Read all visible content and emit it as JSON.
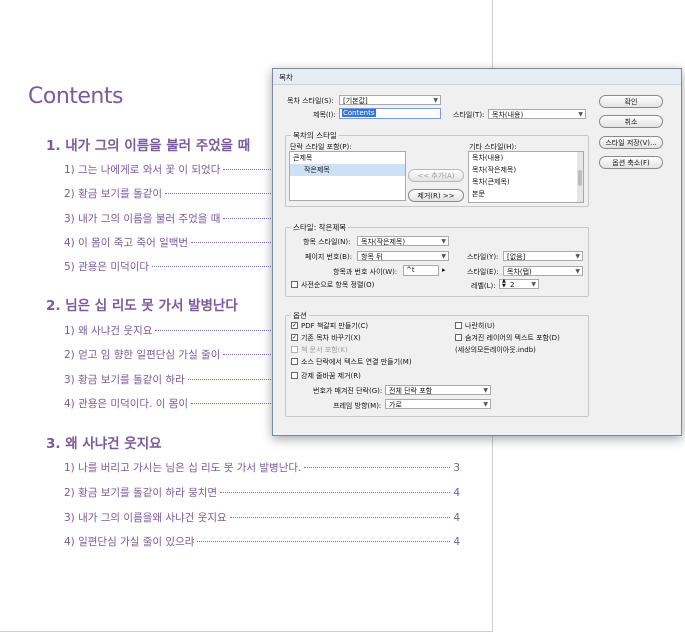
{
  "document": {
    "toc_title": "Contents",
    "sections": [
      {
        "heading": "1. 내가 그의 이름을 불러 주었을 때",
        "items": [
          {
            "text": "1) 그는 나에게로 와서 꽃 이 되었다",
            "page": ""
          },
          {
            "text": "2) 황금 보기를 돌같이",
            "page": ""
          },
          {
            "text": "3) 내가 그의 이름을 불러 주었을 때",
            "page": ""
          },
          {
            "text": "4) 이 몸이 죽고 죽어 일백번",
            "page": ""
          },
          {
            "text": "5) 관용은 미덕이다",
            "page": ""
          }
        ]
      },
      {
        "heading": "2. 님은 십 리도 못 가서 발병난다",
        "items": [
          {
            "text": "1) 왜 사냐건 웃지요",
            "page": ""
          },
          {
            "text": "2) 얻고 임 향한 일편단심 가실 줄이",
            "page": ""
          },
          {
            "text": "3) 황금 보기를 돌같이 하라",
            "page": ""
          },
          {
            "text": "4) 관용은 미덕이다. 이 몸이",
            "page": ""
          }
        ]
      },
      {
        "heading": "3. 왜 사냐건 웃지요",
        "items": [
          {
            "text": "1) 나를 버리고 가시는 님은 십 리도 못 가서 발병난다.",
            "page": "3"
          },
          {
            "text": "2) 황금 보기를 돌같이 하라 뭉치면",
            "page": "4"
          },
          {
            "text": "3) 내가 그의 이름을왜 사냐건 웃지요",
            "page": "4"
          },
          {
            "text": "4) 일편단심 가실 줄이 있으랴",
            "page": "4"
          }
        ]
      }
    ]
  },
  "dialog": {
    "title": "목차",
    "toc_style_label": "목차 스타일(S):",
    "toc_style_value": "[기본값]",
    "title_label": "제목(I):",
    "title_value": "Contents",
    "style_label": "스타일(T):",
    "style_value": "목차(내용)",
    "buttons": {
      "ok": "확인",
      "cancel": "취소",
      "save_style": "스타일 저장(V)...",
      "fewer_options": "옵션 축소(F)",
      "add": "<< 추가(A)",
      "remove": "제거(R) >>"
    },
    "toc_styles_group": "목차의 스타일",
    "include_label": "단락 스타일 포함(P):",
    "include_items": [
      "큰제목",
      "작은제목"
    ],
    "other_label": "기타 스타일(H):",
    "other_items": [
      "목차(내용)",
      "목차(작은제목)",
      "목차(큰제목)",
      "본문"
    ],
    "style_section_group": "스타일: 작은제목",
    "entry_style_label": "항목 스타일(N):",
    "entry_style_value": "목차(작은제목)",
    "page_number_label": "페이지 번호(B):",
    "page_number_value": "항목 뒤",
    "page_style_label": "스타일(Y):",
    "page_style_value": "[없음]",
    "between_label": "항목과 번호 사이(W):",
    "between_value": "^t",
    "between_style_label": "스타일(E):",
    "between_style_value": "목차(탭)",
    "sort_label": "사전순으로 항목 정렬(O)",
    "level_label": "레벨(L):",
    "level_value": "2",
    "options_group": "옵션",
    "opt_pdf": "PDF 책갈피 만들기(C)",
    "opt_replace": "기존 목차 바꾸기(X)",
    "opt_book": "책 문서 포함(K)",
    "opt_run_in": "나란히(U)",
    "opt_hidden": "숨겨진 레이어의 텍스트 포함(D)",
    "opt_hidden_file": "(세상의모든레이아웃.indb)",
    "opt_source": "소스 단락에서 텍스트 연결 만들기(M)",
    "opt_remove_breaks": "강제 줄바꿈 제거(R)",
    "numbered_label": "번호가 매겨진 단락(G):",
    "numbered_value": "전체 단락 포함",
    "frame_dir_label": "프레임 방향(M):",
    "frame_dir_value": "가로"
  }
}
